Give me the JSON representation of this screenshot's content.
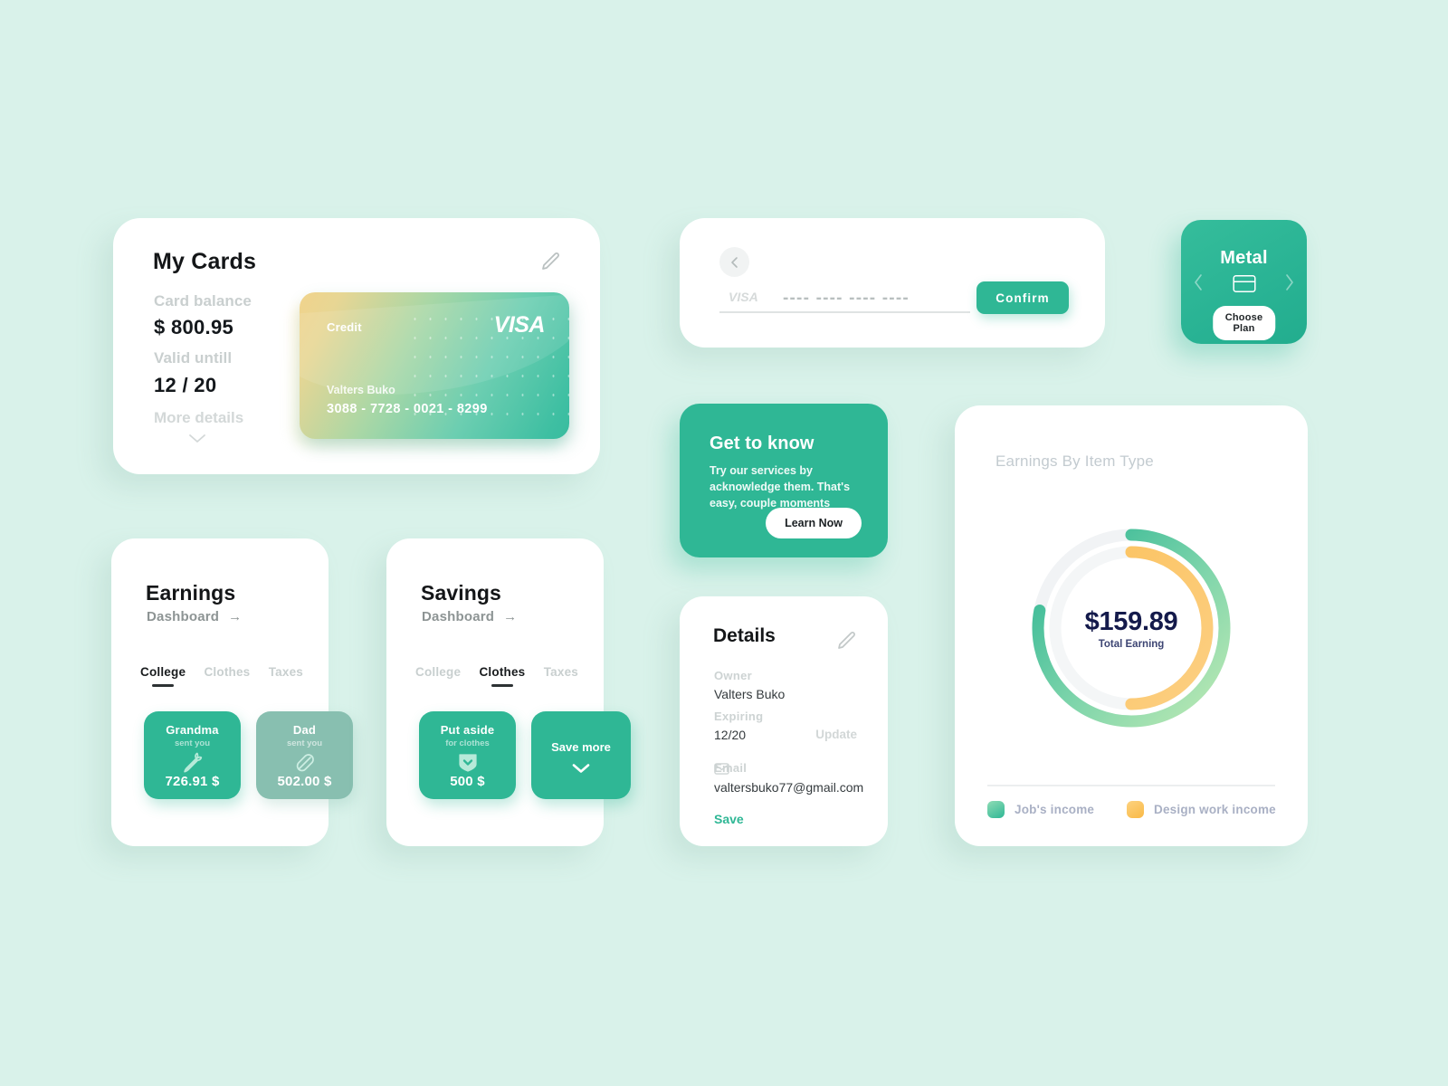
{
  "theme": {
    "background": "#d9f2ea",
    "primary_green": "#2fb795",
    "muted_green": "#88bfb0",
    "accent_orange": "#fbc15c",
    "card_white": "#ffffff",
    "navy_text": "#141a4b"
  },
  "my_cards": {
    "title": "My Cards",
    "edit_icon": "pencil-icon",
    "balance_label": "Card balance",
    "balance_value": "$ 800.95",
    "valid_label": "Valid untill",
    "valid_value": "12 / 20",
    "more_details": "More details",
    "more_details_icon": "chevron-down-icon",
    "credit_card": {
      "type_label": "Credit",
      "brand": "VISA",
      "holder": "Valters Buko",
      "number": "3088  -  7728  -  0021  -  8299"
    }
  },
  "earnings": {
    "title": "Earnings",
    "subtitle": "Dashboard",
    "subtitle_arrow": "→",
    "tabs": [
      {
        "label": "College",
        "active": true
      },
      {
        "label": "Clothes",
        "active": false
      },
      {
        "label": "Taxes",
        "active": false
      }
    ],
    "tiles": [
      {
        "name": "Grandma",
        "sub": "sent you",
        "amount": "726.91 $",
        "icon": "carrot-icon",
        "style": "primary"
      },
      {
        "name": "Dad",
        "sub": "sent you",
        "amount": "502.00 $",
        "icon": "feather-icon",
        "style": "muted"
      }
    ]
  },
  "savings": {
    "title": "Savings",
    "subtitle": "Dashboard",
    "subtitle_arrow": "→",
    "tabs": [
      {
        "label": "College",
        "active": false
      },
      {
        "label": "Clothes",
        "active": true
      },
      {
        "label": "Taxes",
        "active": false
      }
    ],
    "tiles": [
      {
        "name": "Put aside",
        "sub": "for clothes",
        "amount": "500 $",
        "icon": "shield-down-icon",
        "style": "primary"
      },
      {
        "name": "Save more",
        "sub": "",
        "amount": "",
        "icon": "chevron-down-icon",
        "style": "primary"
      }
    ]
  },
  "add_card": {
    "back_icon": "chevron-left-icon",
    "brand_hint": "VISA",
    "card_number_value": "---- ---- ---- ----",
    "card_number_placeholder": "---- ---- ---- ----",
    "confirm_label": "Confirm"
  },
  "metal_plan": {
    "title": "Metal",
    "card_icon": "credit-card-icon",
    "button_label": "Choose Plan",
    "prev_icon": "chevron-left-icon",
    "next_icon": "chevron-right-icon"
  },
  "get_to_know": {
    "title": "Get to know",
    "body": "Try our services by acknowledge them. That's easy, couple moments",
    "button_label": "Learn Now"
  },
  "details": {
    "title": "Details",
    "edit_icon": "pencil-icon",
    "owner_label": "Owner",
    "owner_value": "Valters Buko",
    "expiring_label": "Expiring",
    "expiring_value": "12/20",
    "update_label": "Update",
    "email_icon": "mail-icon",
    "email_label": "Email",
    "email_value": "valtersbuko77@gmail.com",
    "save_label": "Save"
  },
  "chart_card": {
    "title": "Earnings By Item Type",
    "center_amount": "$159.89",
    "center_label": "Total Earning",
    "legend": [
      {
        "label": "Job's income",
        "color": "#3fbf96"
      },
      {
        "label": "Design work income",
        "color": "#fbc15c"
      }
    ]
  },
  "chart_data": {
    "type": "pie",
    "subtype": "donut-progress-rings",
    "title": "Earnings By Item Type",
    "center_value": 159.89,
    "center_value_label": "$159.89",
    "center_sublabel": "Total Earning",
    "legend_position": "bottom",
    "grid": false,
    "track_color": "#f0f2f4",
    "rings": [
      {
        "name": "Job's income",
        "ring": "outer",
        "percent": 78,
        "start_angle_deg": 0,
        "end_angle_deg": 281,
        "color_start": "#b7e8b0",
        "color_end": "#2fb795",
        "radius_px": 103,
        "stroke_px": 13
      },
      {
        "name": "Design work income",
        "ring": "inner",
        "percent": 50,
        "start_angle_deg": 0,
        "end_angle_deg": 180,
        "color_start": "#fbc15c",
        "color_end": "#f9ca74",
        "radius_px": 84,
        "stroke_px": 13
      }
    ],
    "categories": [
      "Job's income",
      "Design work income"
    ],
    "values": [
      78,
      50
    ]
  }
}
